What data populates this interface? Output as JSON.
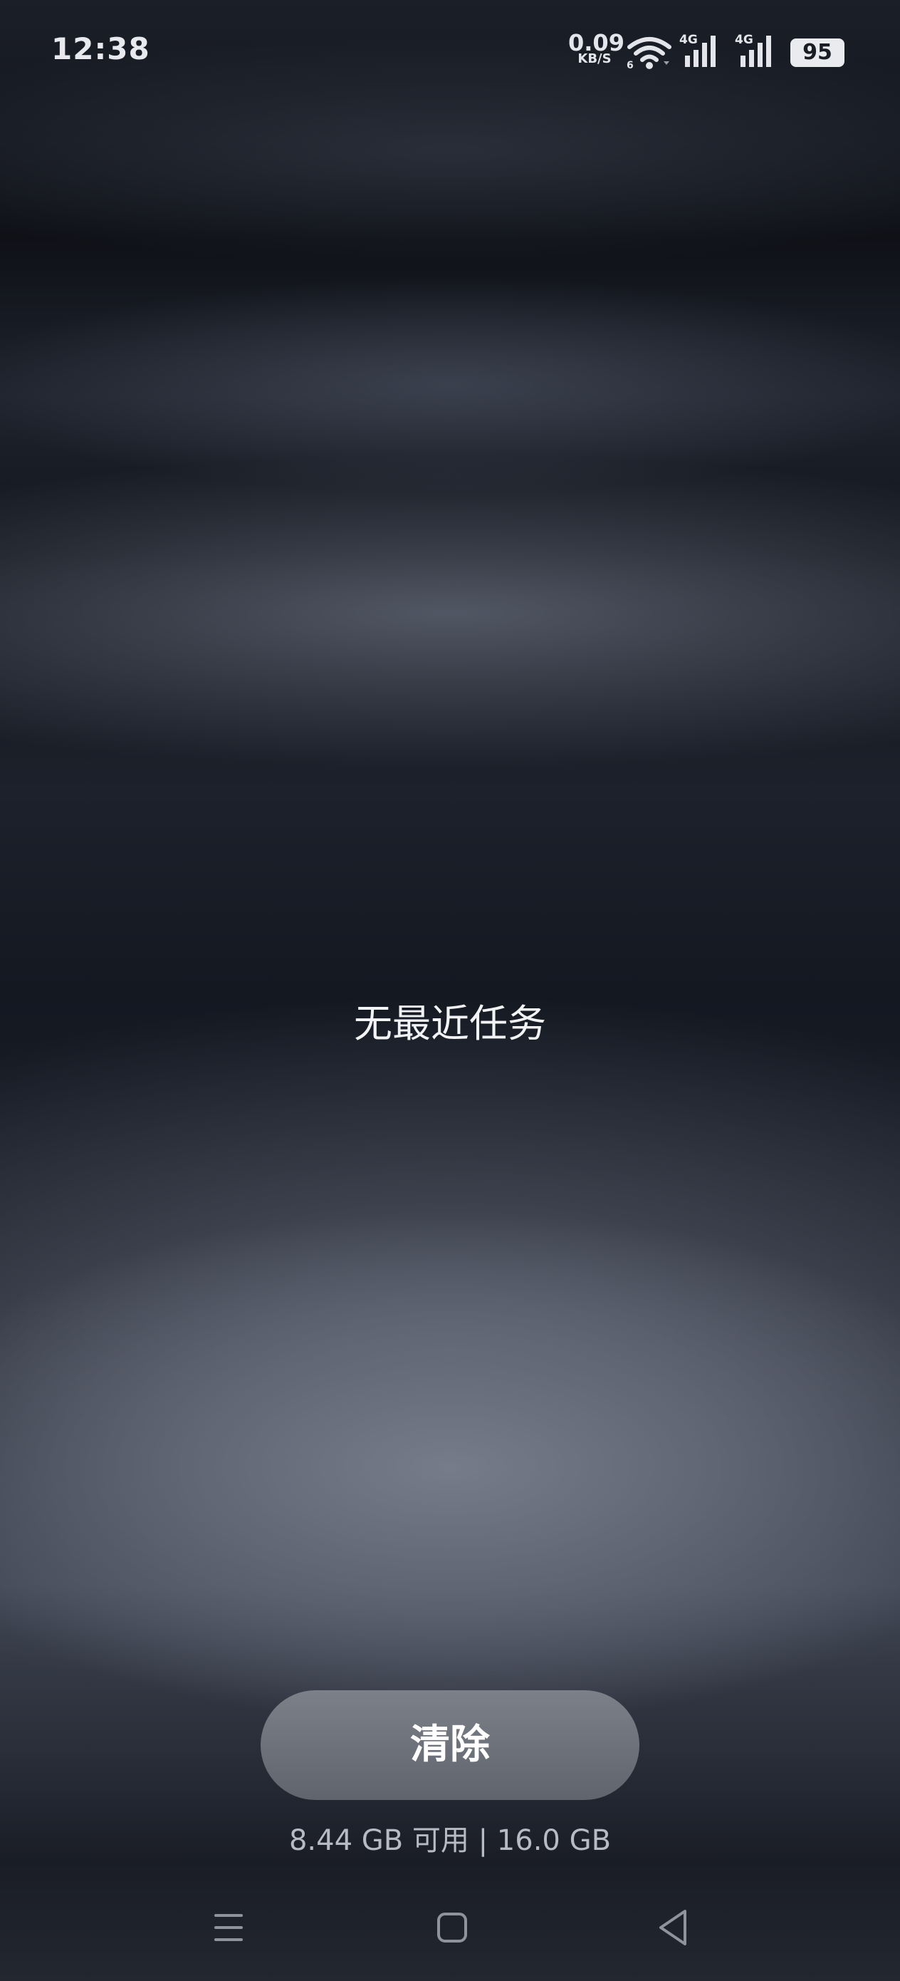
{
  "status_bar": {
    "time": "12:38",
    "net_speed_value": "0.09",
    "net_speed_unit": "KB/S",
    "wifi_icon": "wifi-6-icon",
    "signal_1_label": "4G",
    "signal_2_label": "4G",
    "battery_level": "95"
  },
  "recents": {
    "empty_message": "无最近任务",
    "clear_button_label": "清除",
    "memory_info": "8.44 GB 可用 | 16.0 GB"
  },
  "nav_bar": {
    "menu_icon": "menu-icon",
    "home_icon": "home-icon",
    "back_icon": "back-icon"
  },
  "colors": {
    "text_primary": "#f2f3f5",
    "button_bg": "#6e7279",
    "memory_text": "#b7bbc3"
  }
}
